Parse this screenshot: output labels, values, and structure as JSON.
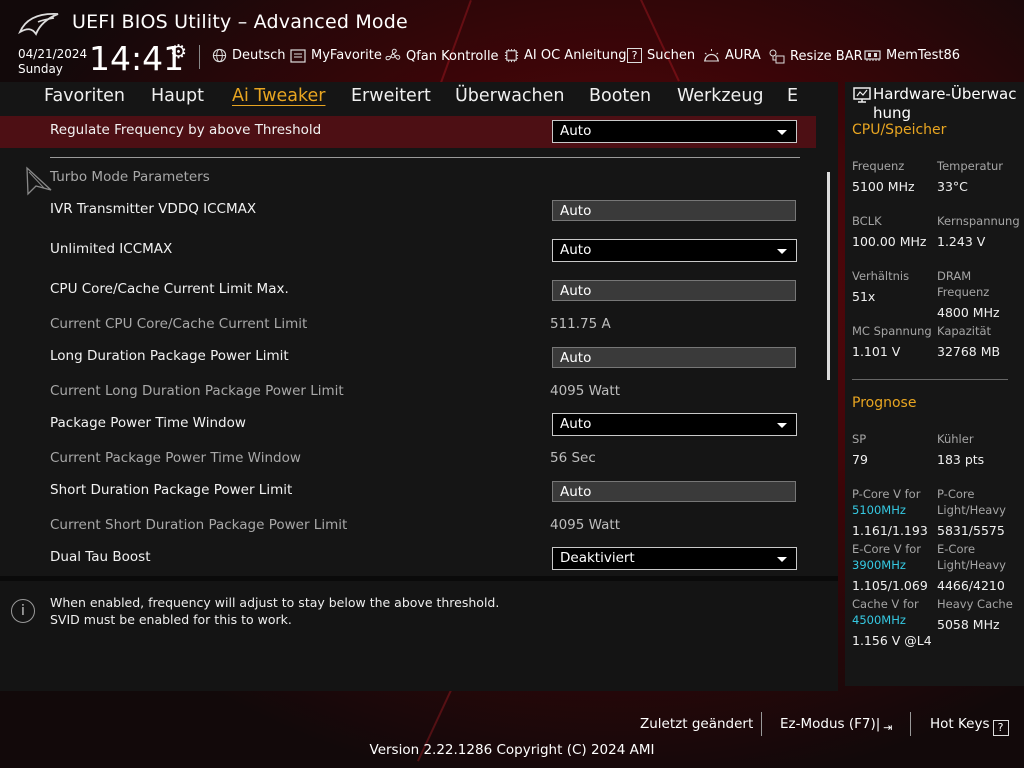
{
  "header": {
    "title": "UEFI BIOS Utility – Advanced Mode",
    "date": "04/21/2024",
    "day": "Sunday",
    "time": "14:41",
    "tools": [
      {
        "label": "Deutsch",
        "icon": "globe-icon"
      },
      {
        "label": "MyFavorite",
        "icon": "favorite-icon"
      },
      {
        "label": "Qfan Kontrolle",
        "icon": "fan-icon"
      },
      {
        "label": "AI OC Anleitung",
        "icon": "ai-chip-icon"
      },
      {
        "label": "Suchen",
        "icon": "search-icon"
      },
      {
        "label": "AURA",
        "icon": "aura-icon"
      },
      {
        "label": "Resize BAR",
        "icon": "resize-bar-icon"
      },
      {
        "label": "MemTest86",
        "icon": "memtest-icon"
      }
    ]
  },
  "tabs": [
    "Favoriten",
    "Haupt",
    "Ai Tweaker",
    "Erweitert",
    "Überwachen",
    "Booten",
    "Werkzeug",
    "E"
  ],
  "active_tab": "Ai Tweaker",
  "settings": {
    "highlighted": {
      "label": "Regulate Frequency by above Threshold",
      "value": "Auto"
    },
    "section_title": "Turbo Mode Parameters",
    "rows": [
      {
        "label": "IVR Transmitter VDDQ ICCMAX",
        "value": "Auto",
        "kind": "field"
      },
      {
        "label": "Unlimited ICCMAX",
        "value": "Auto",
        "kind": "select"
      },
      {
        "label": "CPU Core/Cache Current Limit Max.",
        "value": "Auto",
        "kind": "field"
      },
      {
        "label": "Current CPU Core/Cache Current Limit",
        "value": "511.75 A",
        "kind": "readonly"
      },
      {
        "label": "Long Duration Package Power Limit",
        "value": "Auto",
        "kind": "field"
      },
      {
        "label": "Current Long Duration Package Power Limit",
        "value": "4095 Watt",
        "kind": "readonly"
      },
      {
        "label": "Package Power Time Window",
        "value": "Auto",
        "kind": "select"
      },
      {
        "label": "Current Package Power Time Window",
        "value": "56 Sec",
        "kind": "readonly"
      },
      {
        "label": "Short Duration Package Power Limit",
        "value": "Auto",
        "kind": "field"
      },
      {
        "label": "Current Short Duration Package Power Limit",
        "value": "4095 Watt",
        "kind": "readonly"
      },
      {
        "label": "Dual Tau Boost",
        "value": "Deaktiviert",
        "kind": "select"
      }
    ]
  },
  "help": {
    "line1": "When enabled, frequency will adjust to stay below the above threshold.",
    "line2": "SVID must be enabled for this to work."
  },
  "hw_monitor": {
    "title": "Hardware-Überwac hung",
    "cpu_section": "CPU/Speicher",
    "freq_label": "Frequenz",
    "freq_value": "5100 MHz",
    "temp_label": "Temperatur",
    "temp_value": "33°C",
    "bclk_label": "BCLK",
    "bclk_value": "100.00 MHz",
    "vcore_label": "Kernspannung",
    "vcore_value": "1.243 V",
    "ratio_label": "Verhältnis",
    "ratio_value": "51x",
    "dram_label1": "DRAM",
    "dram_label2": "Frequenz",
    "dram_value": "4800 MHz",
    "mc_label": "MC Spannung",
    "mc_value": "1.101 V",
    "cap_label": "Kapazität",
    "cap_value": "32768 MB",
    "prognose_section": "Prognose",
    "sp_label": "SP",
    "sp_value": "79",
    "cooler_label": "Kühler",
    "cooler_value": "183 pts",
    "pcore_v_label": "P-Core V for",
    "pcore_v_freq": "5100MHz",
    "pcore_v_value": "1.161/1.193",
    "pcore_lh_label1": "P-Core",
    "pcore_lh_label2": "Light/Heavy",
    "pcore_lh_value": "5831/5575",
    "ecore_v_label": "E-Core V for",
    "ecore_v_freq": "3900MHz",
    "ecore_v_value": "1.105/1.069",
    "ecore_lh_label1": "E-Core",
    "ecore_lh_label2": "Light/Heavy",
    "ecore_lh_value": "4466/4210",
    "cache_v_label": "Cache V for",
    "cache_v_freq": "4500MHz",
    "cache_v_value": "1.156 V @L4",
    "heavy_cache_label": "Heavy Cache",
    "heavy_cache_value": "5058 MHz"
  },
  "footer": {
    "last_changed": "Zuletzt geändert",
    "ez_mode": "Ez-Modus (F7)|",
    "hot_keys": "Hot Keys",
    "hot_keys_key": "?",
    "version": "Version 2.22.1286 Copyright (C) 2024 AMI"
  },
  "colors": {
    "accent": "#e8a521",
    "cyan": "#35c9e2",
    "highlight": "#4d0f14"
  }
}
